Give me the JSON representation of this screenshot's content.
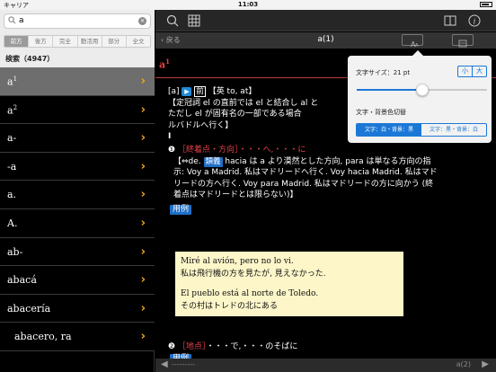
{
  "status": {
    "carrier": "キャリア",
    "time": "11:03"
  },
  "search": {
    "value": "a",
    "clear_label": "×"
  },
  "search_modes": [
    {
      "label": "前方",
      "active": true
    },
    {
      "label": "後方",
      "active": false
    },
    {
      "label": "完全",
      "active": false
    },
    {
      "label": "動活用",
      "active": false
    },
    {
      "label": "部分",
      "active": false
    },
    {
      "label": "全文",
      "active": false
    }
  ],
  "result_count": "検索（4947）",
  "list": [
    {
      "word": "a",
      "sup": "1",
      "selected": true
    },
    {
      "word": "a",
      "sup": "2"
    },
    {
      "word": "a-"
    },
    {
      "word": "-a"
    },
    {
      "word": "a."
    },
    {
      "word": "A."
    },
    {
      "word": "ab-"
    },
    {
      "word": "abacá"
    },
    {
      "word": "abacería"
    },
    {
      "word": "abacero, ra",
      "indent": true
    }
  ],
  "nav": {
    "back": "戻る",
    "title": "a(1)"
  },
  "entry": {
    "headword": "a",
    "headword_sup": "1",
    "pron": "[a]",
    "play": "▶",
    "prep_mark": "前",
    "origin": "【英 to, at】",
    "note": "【定冠詞 el の直前では el と結合し al と",
    "note2": "ただし el が固有名の一部である場合",
    "note3": "ルバドルへ行く】",
    "roman": "I",
    "sense1_num": "❶",
    "sense1_label": "［終着点・方向］",
    "sense1_gloss": "・・・へ,・・・に",
    "sense1_l1_a": "【⇔de.",
    "sense1_tag": "類義",
    "sense1_l1_b": "hacia は a より漠然とした方向, para は単なる方向の指",
    "sense1_l2": "示: Voy a Madrid. 私はマドリードへ行く. Voy hacia Madrid. 私はマド",
    "sense1_l3": "リードの方へ行く. Voy para Madrid. 私はマドリードの方に向かう (終",
    "sense1_l4": "着点はマドリードとは限らない)】",
    "example_tag": "用例",
    "sense2_num": "❷",
    "sense2_label": "［地点］",
    "sense2_gloss": "・・・で,・・・のそばに",
    "sense2_tag": "用例"
  },
  "examples": [
    {
      "es": "Miré al avión, pero no lo vi.",
      "ja": "私は飛行機の方を見たが, 見えなかった."
    },
    {
      "es": "El pueblo está al norte de Toledo.",
      "ja": "その村はトレドの北にある"
    }
  ],
  "bottom": {
    "prev": "---------",
    "next": "a(2)"
  },
  "popover": {
    "font_size_label": "文字サイズ：21 pt",
    "smaller": "小",
    "larger": "大",
    "slider_value": 0.5,
    "color_label": "文字・背景色切替",
    "scheme_a": "文字：白・背景：黒",
    "scheme_b": "文字：黒・背景：白"
  },
  "colors": {
    "accent": "#1c78d6",
    "headword": "#e8424a",
    "chevron": "#f5a623",
    "example_bg": "#fdf6c9"
  }
}
